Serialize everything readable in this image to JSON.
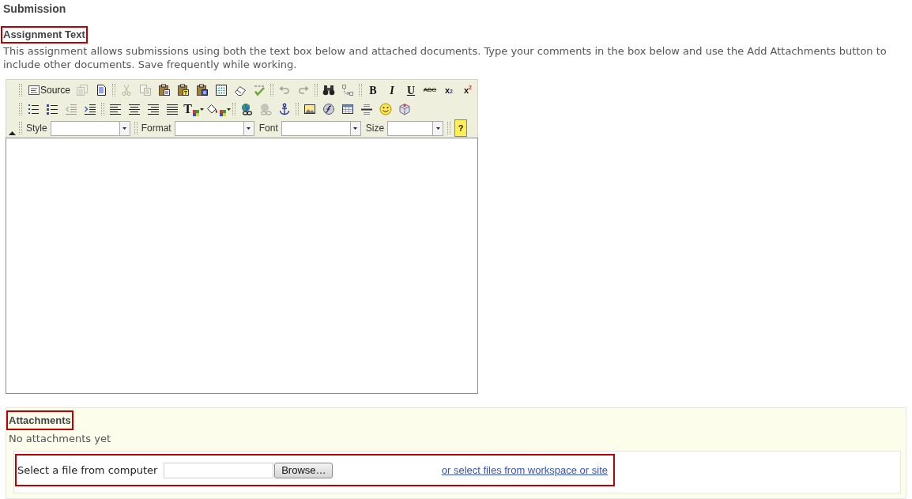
{
  "heading": "Submission",
  "assignment_text": {
    "title": "Assignment Text",
    "highlighted": true,
    "instructions": "This assignment allows submissions using both the text box below and attached documents. Type your comments in the box below and use the Add Attachments button to include other documents. Save frequently while working."
  },
  "editor": {
    "toolbar": [
      [
        {
          "kind": "separator"
        },
        {
          "kind": "source",
          "label": "Source",
          "disabled": false
        },
        {
          "kind": "preview",
          "disabled": true
        },
        {
          "kind": "templates",
          "disabled": false
        },
        {
          "kind": "separator"
        },
        {
          "kind": "cut",
          "disabled": true
        },
        {
          "kind": "copy",
          "disabled": true
        },
        {
          "kind": "paste",
          "disabled": false
        },
        {
          "kind": "pastetext",
          "disabled": false
        },
        {
          "kind": "pasteword",
          "disabled": false
        },
        {
          "kind": "selectall",
          "disabled": false
        },
        {
          "kind": "removeformat",
          "disabled": false
        },
        {
          "kind": "spellcheck",
          "disabled": false
        },
        {
          "kind": "separator"
        },
        {
          "kind": "undo",
          "disabled": true
        },
        {
          "kind": "redo",
          "disabled": true
        },
        {
          "kind": "separator"
        },
        {
          "kind": "find",
          "disabled": false
        },
        {
          "kind": "replace",
          "disabled": false
        },
        {
          "kind": "separator"
        },
        {
          "kind": "bold",
          "label": "B",
          "disabled": false
        },
        {
          "kind": "italic",
          "label": "I",
          "disabled": false
        },
        {
          "kind": "underline",
          "label": "U",
          "disabled": false
        },
        {
          "kind": "strike",
          "label": "ABC",
          "disabled": false
        },
        {
          "kind": "subscript",
          "label": "x$_{2}$",
          "disabled": false
        },
        {
          "kind": "superscript",
          "label": "x$^{2}$",
          "disabled": false
        }
      ],
      [
        {
          "kind": "separator"
        },
        {
          "kind": "orderedlist",
          "disabled": false
        },
        {
          "kind": "unorderedlist",
          "disabled": false
        },
        {
          "kind": "outdent",
          "disabled": true
        },
        {
          "kind": "indent",
          "disabled": false
        },
        {
          "kind": "separator"
        },
        {
          "kind": "alignleft",
          "disabled": false
        },
        {
          "kind": "aligncenter",
          "disabled": false
        },
        {
          "kind": "alignright",
          "disabled": false
        },
        {
          "kind": "justify",
          "disabled": false
        },
        {
          "kind": "textcolor",
          "label": "T",
          "disabled": false
        },
        {
          "kind": "bgcolor",
          "disabled": false
        },
        {
          "kind": "separator"
        },
        {
          "kind": "link",
          "disabled": false
        },
        {
          "kind": "unlink",
          "disabled": true
        },
        {
          "kind": "anchor",
          "disabled": false
        },
        {
          "kind": "separator"
        },
        {
          "kind": "image",
          "disabled": false
        },
        {
          "kind": "flash",
          "disabled": false
        },
        {
          "kind": "table",
          "disabled": false
        },
        {
          "kind": "rule",
          "disabled": false
        },
        {
          "kind": "smiley",
          "disabled": false
        },
        {
          "kind": "specialchar",
          "disabled": false
        }
      ],
      [
        {
          "kind": "separator"
        },
        {
          "kind": "combo",
          "label": "Style"
        },
        {
          "kind": "separator"
        },
        {
          "kind": "combo",
          "label": "Format"
        },
        {
          "kind": "combo",
          "label": "Font"
        },
        {
          "kind": "combo",
          "label": "Size"
        },
        {
          "kind": "separator"
        },
        {
          "kind": "help",
          "label": "?",
          "disabled": false
        }
      ]
    ]
  },
  "attachments": {
    "title": "Attachments",
    "highlighted": true,
    "status": "No attachments yet",
    "upload": {
      "highlighted": true,
      "label": "Select a file from computer",
      "browse_button": "Browse…",
      "link": "or select files from workspace or site"
    }
  }
}
